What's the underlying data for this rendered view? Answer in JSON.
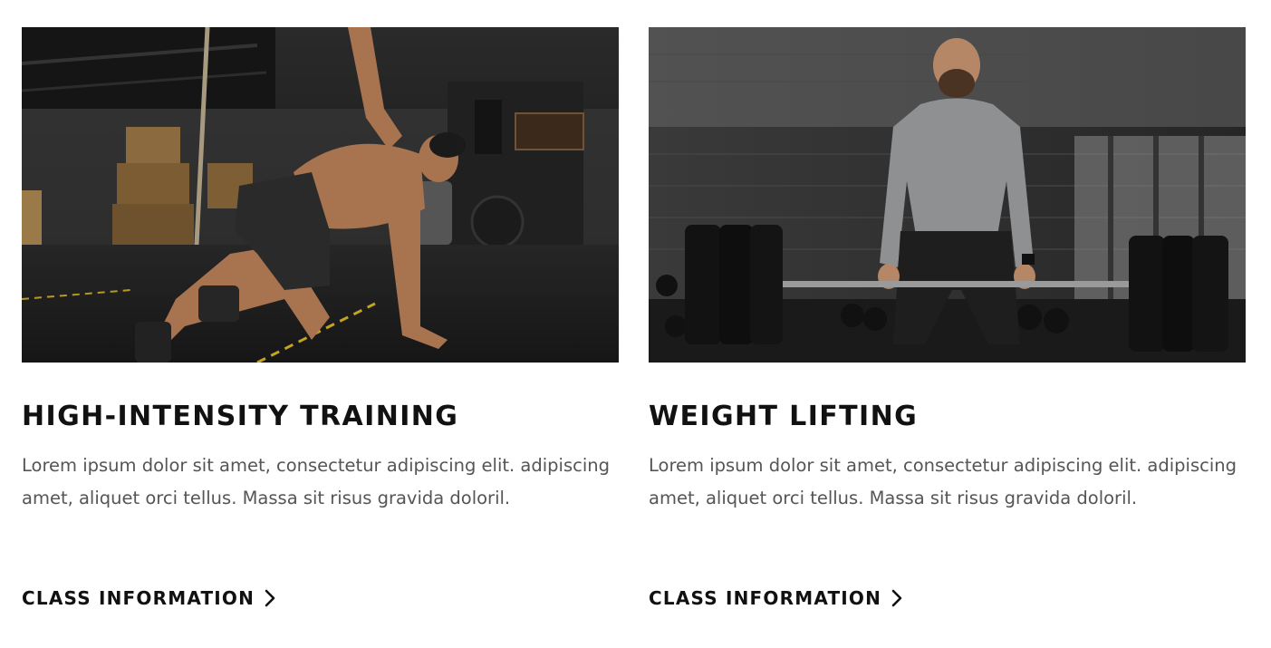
{
  "cards": [
    {
      "image_alt": "Shirtless athlete doing a side plank twist in a dark gym",
      "title": "HIGH-INTENSITY TRAINING",
      "description": "Lorem ipsum dolor sit amet, consectetur adipiscing elit. adipiscing amet, aliquet orci tellus. Massa sit risus gravida doloril.",
      "cta_label": "CLASS INFORMATION",
      "cta_icon": "chevron-right-icon"
    },
    {
      "image_alt": "Man in grey compression shirt deadlifting a barbell in a gym",
      "title": "WEIGHT LIFTING",
      "description": "Lorem ipsum dolor sit amet, consectetur adipiscing elit. adipiscing amet, aliquet orci tellus. Massa sit risus gravida doloril.",
      "cta_label": "CLASS INFORMATION",
      "cta_icon": "chevron-right-icon"
    }
  ],
  "colors": {
    "heading": "#111111",
    "body_text": "#555555",
    "background": "#ffffff"
  }
}
